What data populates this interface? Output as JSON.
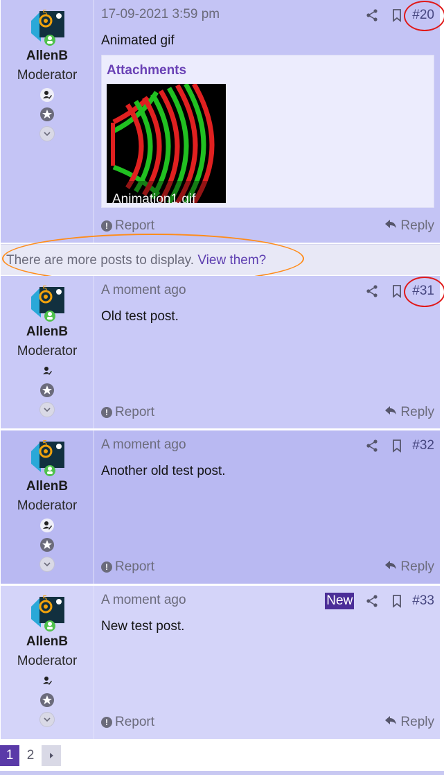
{
  "thread": {
    "posts": [
      {
        "username": "AllenB",
        "user_title": "Moderator",
        "date": "17-09-2021 3:59 pm",
        "number": "#20",
        "body": "Animated gif",
        "attachments_heading": "Attachments",
        "attachment_name": "Animation1.gif",
        "report_label": "Report",
        "reply_label": "Reply"
      },
      {
        "username": "AllenB",
        "user_title": "Moderator",
        "date": "A moment ago",
        "number": "#31",
        "body": "Old test post.",
        "report_label": "Report",
        "reply_label": "Reply"
      },
      {
        "username": "AllenB",
        "user_title": "Moderator",
        "date": "A moment ago",
        "number": "#32",
        "body": "Another old test post.",
        "report_label": "Report",
        "reply_label": "Reply"
      },
      {
        "username": "AllenB",
        "user_title": "Moderator",
        "date": "A moment ago",
        "number": "#33",
        "badge": "New",
        "body": "New test post.",
        "report_label": "Report",
        "reply_label": "Reply"
      }
    ],
    "more_posts": {
      "text": "There are more posts to display.",
      "link": "View them?"
    },
    "pagination": {
      "current": "1",
      "pages": [
        "2"
      ]
    }
  },
  "colors": {
    "highlight_ring": "#e01a1a",
    "more_ring": "#ff8c1a",
    "link": "#5c3db0",
    "accent": "#5a3aa8"
  },
  "icons": [
    "avatar-logo-icon",
    "user-edit-icon",
    "star-badge-icon",
    "chevron-down-icon",
    "share-icon",
    "bookmark-icon",
    "report-icon",
    "reply-icon",
    "chevron-right-icon"
  ]
}
